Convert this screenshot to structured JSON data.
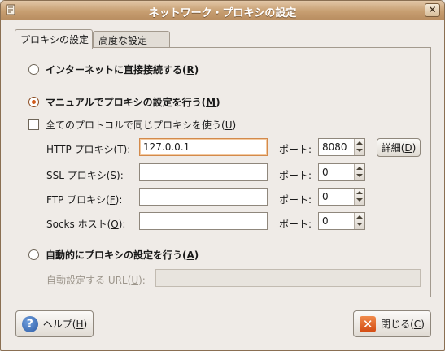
{
  "window": {
    "title": "ネットワーク・プロキシの設定",
    "close_glyph": "✕"
  },
  "tabs": [
    {
      "label": "プロキシの設定",
      "active": true
    },
    {
      "label": "高度な設定",
      "active": false
    }
  ],
  "options": {
    "direct": {
      "label": "インターネットに直接接続する(",
      "mnemonic": "R",
      "suffix": ")",
      "selected": false
    },
    "manual": {
      "label": "マニュアルでプロキシの設定を行う(",
      "mnemonic": "M",
      "suffix": ")",
      "selected": true
    },
    "same_proxy": {
      "label": "全てのプロトコルで同じプロキシを使う(",
      "mnemonic": "U",
      "suffix": ")",
      "checked": false
    },
    "auto": {
      "label": "自動的にプロキシの設定を行う(",
      "mnemonic": "A",
      "suffix": ")",
      "selected": false
    }
  },
  "proxies": {
    "http": {
      "label": "HTTP プロキシ(",
      "mnemonic": "T",
      "suffix": "):",
      "host": "127.0.0.1",
      "port_label": "ポート:",
      "port": "8080"
    },
    "ssl": {
      "label": "SSL プロキシ(",
      "mnemonic": "S",
      "suffix": "):",
      "host": "",
      "port_label": "ポート:",
      "port": "0"
    },
    "ftp": {
      "label": "FTP プロキシ(",
      "mnemonic": "F",
      "suffix": "):",
      "host": "",
      "port_label": "ポート:",
      "port": "0"
    },
    "socks": {
      "label": "Socks ホスト(",
      "mnemonic": "O",
      "suffix": "):",
      "host": "",
      "port_label": "ポート:",
      "port": "0"
    }
  },
  "details_button": {
    "label": "詳細(",
    "mnemonic": "D",
    "suffix": ")"
  },
  "auto_url": {
    "label": "自動設定する URL(",
    "mnemonic": "U",
    "suffix": "):",
    "value": ""
  },
  "buttons": {
    "help": {
      "label": "ヘルプ(",
      "mnemonic": "H",
      "suffix": ")",
      "icon": "help-icon"
    },
    "close": {
      "label": "閉じる(",
      "mnemonic": "C",
      "suffix": ")",
      "icon": "close-icon"
    }
  },
  "colors": {
    "titlebar": "#c89f72",
    "radio_accent": "#d05a1b"
  }
}
